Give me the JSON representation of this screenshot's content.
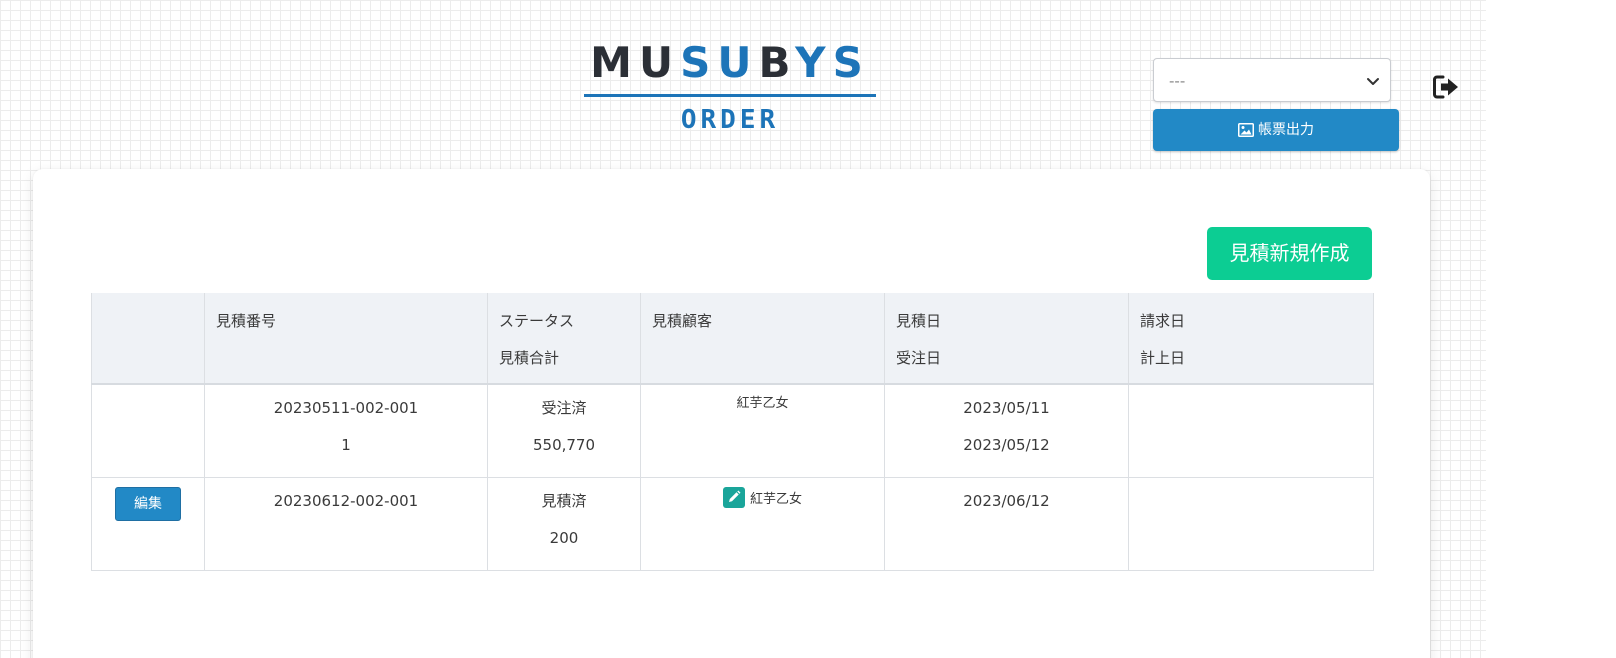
{
  "brand": {
    "logo_text_dark_1": "MU",
    "logo_text_blue_1": "SU",
    "logo_text_dark_2": "B",
    "logo_text_blue_2": "YS",
    "logo_subtitle": "ORDER",
    "logo_accent_color": "#1d74b8"
  },
  "toolbar": {
    "select_value": "---",
    "export_label": "帳票出力",
    "export_icon": "image-icon",
    "logout_icon": "sign-out-icon"
  },
  "actions": {
    "new_estimate_label": "見積新規作成",
    "new_estimate_color": "#0ccd93"
  },
  "table": {
    "headers": [
      {
        "line1": "",
        "line2": ""
      },
      {
        "line1": "見積番号",
        "line2": ""
      },
      {
        "line1": "ステータス",
        "line2": "見積合計"
      },
      {
        "line1": "見積顧客",
        "line2": ""
      },
      {
        "line1": "見積日",
        "line2": "受注日"
      },
      {
        "line1": "請求日",
        "line2": "計上日"
      }
    ],
    "rows": [
      {
        "edit_label": "",
        "estimate_no": "20230511-002-001",
        "estimate_sub": "1",
        "status": "受注済",
        "total": "550,770",
        "customer": "紅芋乙女",
        "estimate_date": "2023/05/11",
        "order_date": "2023/05/12",
        "billing_date": "",
        "posting_date": ""
      },
      {
        "edit_label": "編集",
        "estimate_no": "20230612-002-001",
        "estimate_sub": "",
        "status": "見積済",
        "total": "200",
        "customer": "紅芋乙女",
        "estimate_date": "2023/06/12",
        "order_date": "",
        "billing_date": "",
        "posting_date": ""
      }
    ]
  }
}
